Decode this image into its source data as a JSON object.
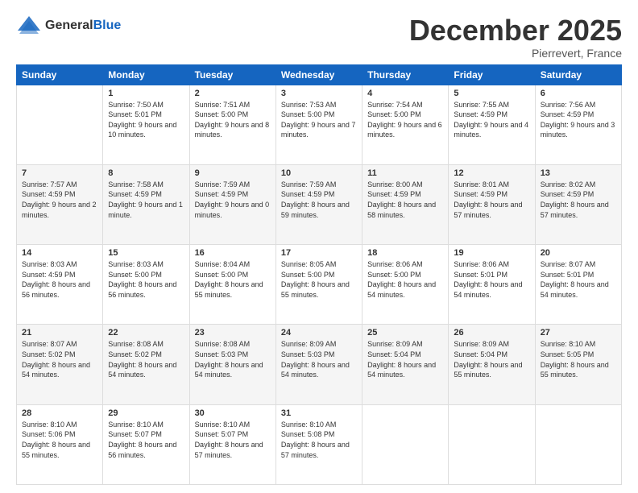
{
  "header": {
    "logo_general": "General",
    "logo_blue": "Blue",
    "month_title": "December 2025",
    "location": "Pierrevert, France"
  },
  "weekdays": [
    "Sunday",
    "Monday",
    "Tuesday",
    "Wednesday",
    "Thursday",
    "Friday",
    "Saturday"
  ],
  "weeks": [
    [
      {
        "day": "",
        "sunrise": "",
        "sunset": "",
        "daylight": ""
      },
      {
        "day": "1",
        "sunrise": "Sunrise: 7:50 AM",
        "sunset": "Sunset: 5:01 PM",
        "daylight": "Daylight: 9 hours and 10 minutes."
      },
      {
        "day": "2",
        "sunrise": "Sunrise: 7:51 AM",
        "sunset": "Sunset: 5:00 PM",
        "daylight": "Daylight: 9 hours and 8 minutes."
      },
      {
        "day": "3",
        "sunrise": "Sunrise: 7:53 AM",
        "sunset": "Sunset: 5:00 PM",
        "daylight": "Daylight: 9 hours and 7 minutes."
      },
      {
        "day": "4",
        "sunrise": "Sunrise: 7:54 AM",
        "sunset": "Sunset: 5:00 PM",
        "daylight": "Daylight: 9 hours and 6 minutes."
      },
      {
        "day": "5",
        "sunrise": "Sunrise: 7:55 AM",
        "sunset": "Sunset: 4:59 PM",
        "daylight": "Daylight: 9 hours and 4 minutes."
      },
      {
        "day": "6",
        "sunrise": "Sunrise: 7:56 AM",
        "sunset": "Sunset: 4:59 PM",
        "daylight": "Daylight: 9 hours and 3 minutes."
      }
    ],
    [
      {
        "day": "7",
        "sunrise": "Sunrise: 7:57 AM",
        "sunset": "Sunset: 4:59 PM",
        "daylight": "Daylight: 9 hours and 2 minutes."
      },
      {
        "day": "8",
        "sunrise": "Sunrise: 7:58 AM",
        "sunset": "Sunset: 4:59 PM",
        "daylight": "Daylight: 9 hours and 1 minute."
      },
      {
        "day": "9",
        "sunrise": "Sunrise: 7:59 AM",
        "sunset": "Sunset: 4:59 PM",
        "daylight": "Daylight: 9 hours and 0 minutes."
      },
      {
        "day": "10",
        "sunrise": "Sunrise: 7:59 AM",
        "sunset": "Sunset: 4:59 PM",
        "daylight": "Daylight: 8 hours and 59 minutes."
      },
      {
        "day": "11",
        "sunrise": "Sunrise: 8:00 AM",
        "sunset": "Sunset: 4:59 PM",
        "daylight": "Daylight: 8 hours and 58 minutes."
      },
      {
        "day": "12",
        "sunrise": "Sunrise: 8:01 AM",
        "sunset": "Sunset: 4:59 PM",
        "daylight": "Daylight: 8 hours and 57 minutes."
      },
      {
        "day": "13",
        "sunrise": "Sunrise: 8:02 AM",
        "sunset": "Sunset: 4:59 PM",
        "daylight": "Daylight: 8 hours and 57 minutes."
      }
    ],
    [
      {
        "day": "14",
        "sunrise": "Sunrise: 8:03 AM",
        "sunset": "Sunset: 4:59 PM",
        "daylight": "Daylight: 8 hours and 56 minutes."
      },
      {
        "day": "15",
        "sunrise": "Sunrise: 8:03 AM",
        "sunset": "Sunset: 5:00 PM",
        "daylight": "Daylight: 8 hours and 56 minutes."
      },
      {
        "day": "16",
        "sunrise": "Sunrise: 8:04 AM",
        "sunset": "Sunset: 5:00 PM",
        "daylight": "Daylight: 8 hours and 55 minutes."
      },
      {
        "day": "17",
        "sunrise": "Sunrise: 8:05 AM",
        "sunset": "Sunset: 5:00 PM",
        "daylight": "Daylight: 8 hours and 55 minutes."
      },
      {
        "day": "18",
        "sunrise": "Sunrise: 8:06 AM",
        "sunset": "Sunset: 5:00 PM",
        "daylight": "Daylight: 8 hours and 54 minutes."
      },
      {
        "day": "19",
        "sunrise": "Sunrise: 8:06 AM",
        "sunset": "Sunset: 5:01 PM",
        "daylight": "Daylight: 8 hours and 54 minutes."
      },
      {
        "day": "20",
        "sunrise": "Sunrise: 8:07 AM",
        "sunset": "Sunset: 5:01 PM",
        "daylight": "Daylight: 8 hours and 54 minutes."
      }
    ],
    [
      {
        "day": "21",
        "sunrise": "Sunrise: 8:07 AM",
        "sunset": "Sunset: 5:02 PM",
        "daylight": "Daylight: 8 hours and 54 minutes."
      },
      {
        "day": "22",
        "sunrise": "Sunrise: 8:08 AM",
        "sunset": "Sunset: 5:02 PM",
        "daylight": "Daylight: 8 hours and 54 minutes."
      },
      {
        "day": "23",
        "sunrise": "Sunrise: 8:08 AM",
        "sunset": "Sunset: 5:03 PM",
        "daylight": "Daylight: 8 hours and 54 minutes."
      },
      {
        "day": "24",
        "sunrise": "Sunrise: 8:09 AM",
        "sunset": "Sunset: 5:03 PM",
        "daylight": "Daylight: 8 hours and 54 minutes."
      },
      {
        "day": "25",
        "sunrise": "Sunrise: 8:09 AM",
        "sunset": "Sunset: 5:04 PM",
        "daylight": "Daylight: 8 hours and 54 minutes."
      },
      {
        "day": "26",
        "sunrise": "Sunrise: 8:09 AM",
        "sunset": "Sunset: 5:04 PM",
        "daylight": "Daylight: 8 hours and 55 minutes."
      },
      {
        "day": "27",
        "sunrise": "Sunrise: 8:10 AM",
        "sunset": "Sunset: 5:05 PM",
        "daylight": "Daylight: 8 hours and 55 minutes."
      }
    ],
    [
      {
        "day": "28",
        "sunrise": "Sunrise: 8:10 AM",
        "sunset": "Sunset: 5:06 PM",
        "daylight": "Daylight: 8 hours and 55 minutes."
      },
      {
        "day": "29",
        "sunrise": "Sunrise: 8:10 AM",
        "sunset": "Sunset: 5:07 PM",
        "daylight": "Daylight: 8 hours and 56 minutes."
      },
      {
        "day": "30",
        "sunrise": "Sunrise: 8:10 AM",
        "sunset": "Sunset: 5:07 PM",
        "daylight": "Daylight: 8 hours and 57 minutes."
      },
      {
        "day": "31",
        "sunrise": "Sunrise: 8:10 AM",
        "sunset": "Sunset: 5:08 PM",
        "daylight": "Daylight: 8 hours and 57 minutes."
      },
      {
        "day": "",
        "sunrise": "",
        "sunset": "",
        "daylight": ""
      },
      {
        "day": "",
        "sunrise": "",
        "sunset": "",
        "daylight": ""
      },
      {
        "day": "",
        "sunrise": "",
        "sunset": "",
        "daylight": ""
      }
    ]
  ]
}
